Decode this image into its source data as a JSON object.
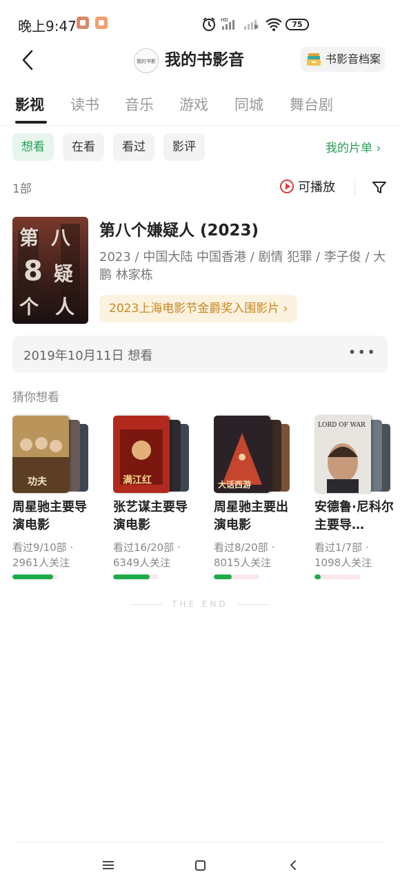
{
  "status_bar": {
    "time": "晚上9:47",
    "battery": "75"
  },
  "header": {
    "title": "我的书影音",
    "archive_label": "书影音档案",
    "logo_text": "我的书影音"
  },
  "tabs": [
    {
      "label": "影视",
      "active": true
    },
    {
      "label": "读书",
      "active": false
    },
    {
      "label": "音乐",
      "active": false
    },
    {
      "label": "游戏",
      "active": false
    },
    {
      "label": "同城",
      "active": false
    },
    {
      "label": "舞台剧",
      "active": false
    }
  ],
  "filters": {
    "items": [
      "想看",
      "在看",
      "看过",
      "影评"
    ],
    "active": "想看",
    "my_list": "我的片单"
  },
  "list_header": {
    "count": "1部",
    "playable": "可播放"
  },
  "movie": {
    "title": "第八个嫌疑人 (2023)",
    "meta": "2023 / 中国大陆 中国香港 / 剧情 犯罪 / 李子俊 / 大鹏 林家栋",
    "award": "2023上海电影节金爵奖入围影片",
    "poster_text": "第八个嫌疑人",
    "date": "2019年10月11日 想看"
  },
  "guess_title": "猜你想看",
  "recommendations": [
    {
      "title": "周星驰主要导演电影",
      "stats1": "看过9/10部 ·",
      "stats2": "2961人关注",
      "progress": 0.9,
      "poster_color": "#b9955c",
      "poster_text": "功夫"
    },
    {
      "title": "张艺谋主要导演电影",
      "stats1": "看过16/20部 ·",
      "stats2": "6349人关注",
      "progress": 0.8,
      "poster_color": "#b12a1d",
      "poster_text": "满江红"
    },
    {
      "title": "周星驰主要出演电影",
      "stats1": "看过8/20部 ·",
      "stats2": "8015人关注",
      "progress": 0.4,
      "poster_color": "#c6452e",
      "poster_text": "大话西游"
    },
    {
      "title": "安德鲁·尼科尔主要导…",
      "stats1": "看过1/7部 ·",
      "stats2": "1098人关注",
      "progress": 0.14,
      "poster_color": "#e8e5e0",
      "poster_text": "LORD OF WAR"
    }
  ],
  "end_text": "THE END",
  "colors": {
    "accent_green": "#2a9d55",
    "award_bg": "#fcf2e0",
    "award_text": "#c98722",
    "progress_green": "#1fab4c",
    "play_red": "#e03a3a"
  }
}
